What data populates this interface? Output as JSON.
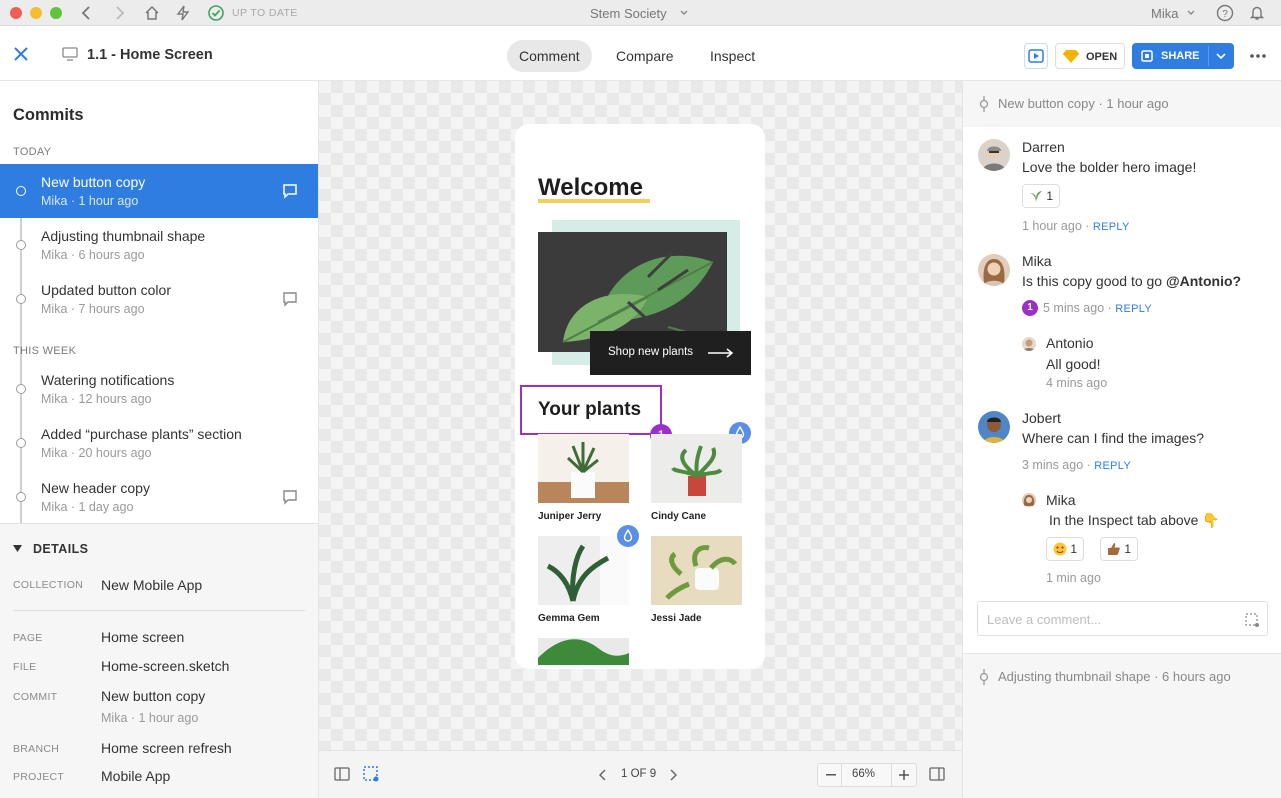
{
  "titlebar": {
    "status": "UP TO DATE",
    "document": "Stem Society",
    "user": "Mika"
  },
  "toolbar": {
    "page_title": "1.1 - Home Screen",
    "tabs": [
      {
        "label": "Comment"
      },
      {
        "label": "Compare"
      },
      {
        "label": "Inspect"
      }
    ],
    "open_label": "OPEN",
    "share_label": "SHARE"
  },
  "sidebar": {
    "title": "Commits",
    "today_label": "TODAY",
    "week_label": "THIS WEEK",
    "commits": [
      {
        "title": "New button copy",
        "meta": "Mika · 1 hour ago"
      },
      {
        "title": "Adjusting thumbnail shape",
        "meta": "Mika · 6 hours ago"
      },
      {
        "title": "Updated button color",
        "meta": "Mika · 7 hours ago"
      },
      {
        "title": "Watering notifications",
        "meta": "Mika · 12 hours ago"
      },
      {
        "title": "Added “purchase plants” section",
        "meta": "Mika · 20 hours ago"
      },
      {
        "title": "New header copy",
        "meta": "Mika · 1 day ago"
      }
    ]
  },
  "details": {
    "label": "DETAILS",
    "collection_key": "COLLECTION",
    "collection": "New Mobile App",
    "page_key": "PAGE",
    "page": "Home screen",
    "file_key": "FILE",
    "file": "Home-screen.sketch",
    "commit_key": "COMMIT",
    "commit": "New button copy",
    "commit_meta": "Mika · 1 hour ago",
    "branch_key": "BRANCH",
    "branch": "Home screen refresh",
    "project_key": "PROJECT",
    "project": "Mobile App"
  },
  "artboard": {
    "welcome": "Welcome",
    "cta": "Shop new plants",
    "section": "Your plants",
    "plants": [
      {
        "name": "Juniper Jerry"
      },
      {
        "name": "Cindy Cane"
      },
      {
        "name": "Gemma Gem"
      },
      {
        "name": "Jessi Jade"
      }
    ],
    "badge_number": "1"
  },
  "bottombar": {
    "page_indicator": "1 OF 9",
    "zoom": "66%"
  },
  "comments": {
    "header": "New button copy · 1 hour ago",
    "threads": [
      {
        "name": "Darren",
        "text": "Love the bolder hero image!",
        "reaction_count": "1",
        "time": "1 hour ago",
        "reply": "REPLY"
      },
      {
        "name": "Mika",
        "text_plain": "Is this copy good to go ",
        "mention": "@Antonio?",
        "time": "5 mins ago",
        "reply": "REPLY",
        "count": "1"
      },
      {
        "name": "Antonio",
        "text": "All good!",
        "time": "4 mins ago"
      },
      {
        "name": "Jobert",
        "text": "Where can I find the images?",
        "time": "3 mins ago",
        "reply": "REPLY"
      },
      {
        "name": "Mika",
        "text": "In the Inspect tab above 👇",
        "reaction1": "1",
        "reaction2": "1",
        "time": "1 min ago"
      }
    ],
    "input_placeholder": "Leave a comment...",
    "footer": "Adjusting thumbnail shape · 6 hours ago"
  },
  "colors": {
    "accent": "#2f7de1",
    "badge_purple": "#9b30c9",
    "badge_blue": "#5b8ee6",
    "selection": "#9b30c9"
  }
}
